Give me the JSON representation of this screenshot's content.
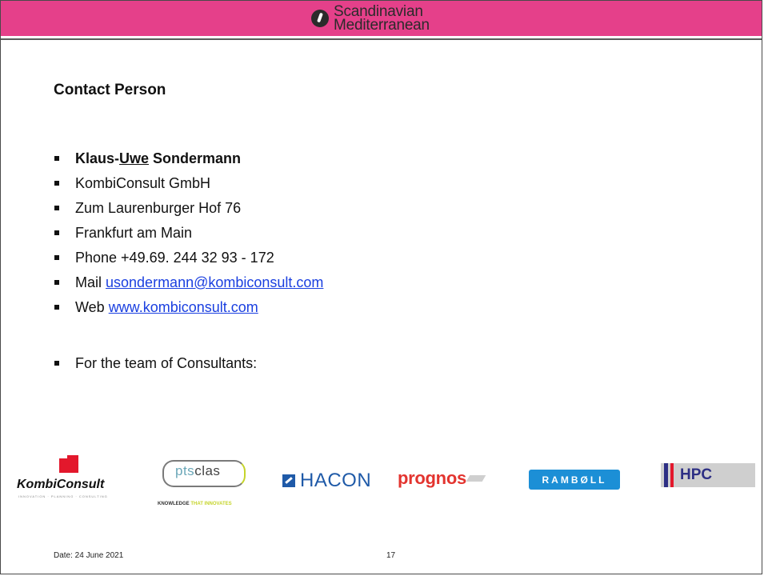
{
  "header": {
    "accent_color": "#e5408a",
    "logo_line1": "Scandinavian",
    "logo_line2": "Mediterranean",
    "logo_icon": "corridor-logo-icon"
  },
  "title": "Contact Person",
  "contact": {
    "name_first": "Klaus-",
    "name_middle": "Uwe",
    "name_last": " Sondermann",
    "company": "KombiConsult GmbH",
    "street": "Zum Laurenburger Hof 76",
    "city": "Frankfurt am Main",
    "phone": "Phone +49.69. 244 32 93 - 172",
    "mail_label": "Mail ",
    "mail_link": "usondermann@kombiconsult.com",
    "web_label": "Web ",
    "web_link": "www.kombiconsult.com",
    "team": "For the team of Consultants:"
  },
  "logos": {
    "kombiconsult": "KombiConsult",
    "kombiconsult_sub": "INNOVATION · PLANNING · CONSULTING",
    "ptsclas_a": "pts",
    "ptsclas_b": "clas",
    "ptsclas_tag_a": "KNOWLEDGE ",
    "ptsclas_tag_b": "THAT INNOVATES",
    "hacon": "HACON",
    "prognos": "prognos",
    "ramboll": "RAMBØLL",
    "hpc": "HPC"
  },
  "footer": {
    "date": "Date: 24 June 2021",
    "page": "17"
  }
}
